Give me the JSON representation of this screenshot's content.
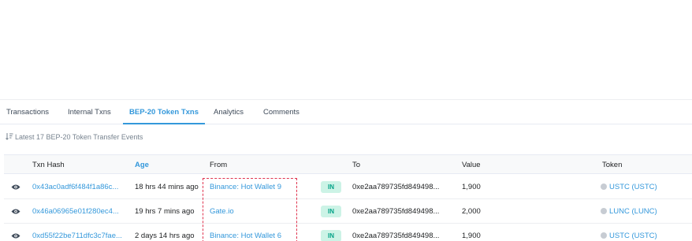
{
  "tabs": [
    {
      "label": "Transactions",
      "active": false
    },
    {
      "label": "Internal Txns",
      "active": false
    },
    {
      "label": "BEP-20 Token Txns",
      "active": true
    },
    {
      "label": "Analytics",
      "active": false
    },
    {
      "label": "Comments",
      "active": false
    }
  ],
  "summary": "Latest 17 BEP-20 Token Transfer Events",
  "columns": {
    "txn_hash": "Txn Hash",
    "age": "Age",
    "from": "From",
    "to": "To",
    "value": "Value",
    "token": "Token"
  },
  "rows": [
    {
      "txn_hash": "0x43ac0adf6f484f1a86c...",
      "age": "18 hrs 44 mins ago",
      "from": "Binance: Hot Wallet 9",
      "direction": "IN",
      "to": "0xe2aa789735fd849498...",
      "value": "1,900",
      "token": "USTC (USTC)"
    },
    {
      "txn_hash": "0x46a06965e01f280ec4...",
      "age": "19 hrs 7 mins ago",
      "from": "Gate.io",
      "direction": "IN",
      "to": "0xe2aa789735fd849498...",
      "value": "2,000",
      "token": "LUNC (LUNC)"
    },
    {
      "txn_hash": "0xd55f22be711dfc3c7fae...",
      "age": "2 days 14 hrs ago",
      "from": "Binance: Hot Wallet 6",
      "direction": "IN",
      "to": "0xe2aa789735fd849498...",
      "value": "1,900",
      "token": "USTC (USTC)"
    }
  ],
  "colors": {
    "link": "#3498db",
    "badge_in_bg": "#ccf3e6",
    "badge_in_text": "#00a186",
    "highlight": "#e0344f"
  }
}
